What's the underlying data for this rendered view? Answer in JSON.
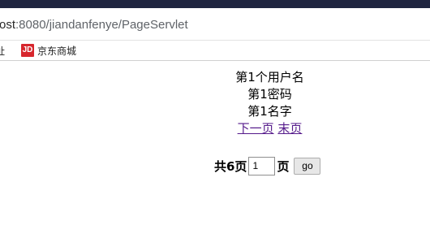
{
  "browser": {
    "url_host": "ost",
    "url_rest": ":8080/jiandanfenye/PageServlet",
    "bookmarks": [
      {
        "label": "址"
      },
      {
        "label": "京东商城",
        "icon": "JD"
      }
    ]
  },
  "page": {
    "lines": [
      "第1个用户名",
      "第1密码",
      "第1名字"
    ],
    "links": {
      "next": "下一页",
      "last": "末页"
    },
    "goto": {
      "total_label": "共6页",
      "input_value": "1",
      "page_label": "页",
      "button_label": "go"
    }
  },
  "colors": {
    "titlebar": "#1f2540",
    "link_visited": "#551a8b",
    "jd_red": "#d7262d"
  }
}
